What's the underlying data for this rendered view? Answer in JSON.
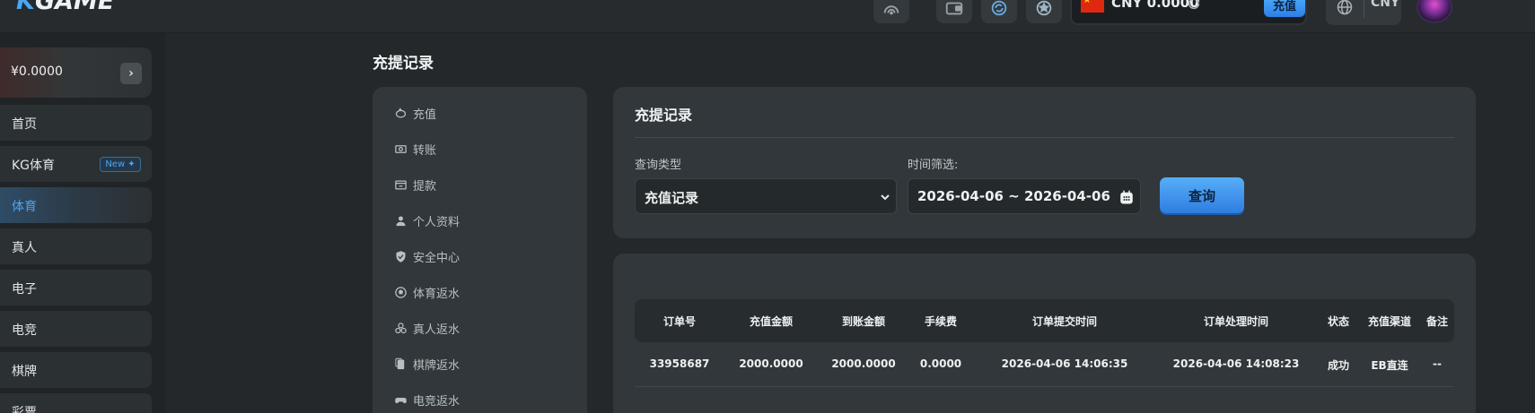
{
  "header": {
    "logo_prefix": "K",
    "logo_rest": "GAME",
    "wallet_amount": "CNY 0.0000",
    "recharge_label": "充值",
    "language": "CNY"
  },
  "sidebar": {
    "balance": "¥0.0000",
    "items": [
      {
        "label": "首页"
      },
      {
        "label": "KG体育",
        "badge": "New ✦"
      },
      {
        "label": "体育"
      },
      {
        "label": "真人"
      },
      {
        "label": "电子"
      },
      {
        "label": "电竞"
      },
      {
        "label": "棋牌"
      },
      {
        "label": "彩票"
      }
    ]
  },
  "main": {
    "page_title": "充提记录",
    "submenu": [
      {
        "label": "充值",
        "icon": "piggy-bank-icon"
      },
      {
        "label": "转账",
        "icon": "cash-icon"
      },
      {
        "label": "提款",
        "icon": "atm-icon"
      },
      {
        "label": "个人资料",
        "icon": "user-icon"
      },
      {
        "label": "安全中心",
        "icon": "shield-icon"
      },
      {
        "label": "体育返水",
        "icon": "soccer-ball-icon"
      },
      {
        "label": "真人返水",
        "icon": "chips-icon"
      },
      {
        "label": "棋牌返水",
        "icon": "cards-icon"
      },
      {
        "label": "电竞返水",
        "icon": "gamepad-icon"
      }
    ],
    "query_panel": {
      "title": "充提记录",
      "type_label": "查询类型",
      "type_value": "充值记录",
      "time_label": "时间筛选:",
      "date_range": "2026-04-06 ~ 2026-04-06",
      "query_button": "查询"
    },
    "table": {
      "columns": [
        "订单号",
        "充值金额",
        "到账金额",
        "手续费",
        "订单提交时间",
        "订单处理时间",
        "状态",
        "充值渠道",
        "备注"
      ],
      "rows": [
        [
          "33958687",
          "2000.0000",
          "2000.0000",
          "0.0000",
          "2026-04-06 14:06:35",
          "2026-04-06 14:08:23",
          "成功",
          "EB直连",
          "--"
        ]
      ]
    }
  },
  "colors": {
    "accent": "#4aa6f5",
    "background": "#24282a",
    "panel": "#31373a"
  }
}
